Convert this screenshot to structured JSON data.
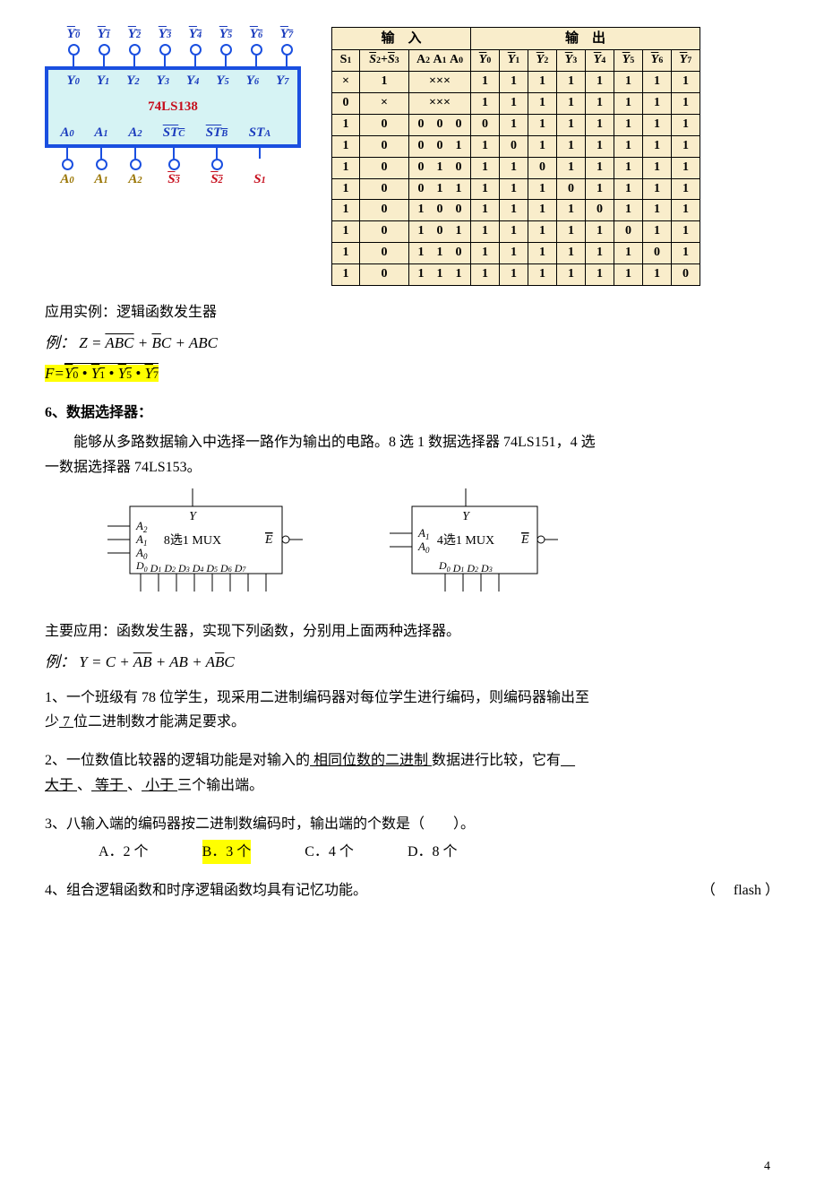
{
  "chip": {
    "name": "74LS138",
    "top_ext": [
      "Y0",
      "Y1",
      "Y2",
      "Y3",
      "Y4",
      "Y5",
      "Y6",
      "Y7"
    ],
    "top_int": [
      "Y0",
      "Y1",
      "Y2",
      "Y3",
      "Y4",
      "Y5",
      "Y6",
      "Y7"
    ],
    "bot_int": [
      "A0",
      "A1",
      "A2",
      "STC",
      "STB",
      "STA"
    ],
    "bot_ext": [
      "A0",
      "A1",
      "A2",
      "S3",
      "S2",
      "S1"
    ]
  },
  "truth_table": {
    "input_label": "输　入",
    "output_label": "输　出",
    "cols_in": [
      "S1",
      "S̄2+S̄3",
      "A2 A1 A0"
    ],
    "cols_out": [
      "Y0",
      "Y1",
      "Y2",
      "Y3",
      "Y4",
      "Y5",
      "Y6",
      "Y7"
    ],
    "rows": [
      {
        "s1": "×",
        "s23": "1",
        "a": "×××",
        "y": [
          "1",
          "1",
          "1",
          "1",
          "1",
          "1",
          "1",
          "1"
        ]
      },
      {
        "s1": "0",
        "s23": "×",
        "a": "×××",
        "y": [
          "1",
          "1",
          "1",
          "1",
          "1",
          "1",
          "1",
          "1"
        ]
      },
      {
        "s1": "1",
        "s23": "0",
        "a": "0  0  0",
        "y": [
          "0",
          "1",
          "1",
          "1",
          "1",
          "1",
          "1",
          "1"
        ]
      },
      {
        "s1": "1",
        "s23": "0",
        "a": "0  0  1",
        "y": [
          "1",
          "0",
          "1",
          "1",
          "1",
          "1",
          "1",
          "1"
        ]
      },
      {
        "s1": "1",
        "s23": "0",
        "a": "0  1  0",
        "y": [
          "1",
          "1",
          "0",
          "1",
          "1",
          "1",
          "1",
          "1"
        ]
      },
      {
        "s1": "1",
        "s23": "0",
        "a": "0  1  1",
        "y": [
          "1",
          "1",
          "1",
          "0",
          "1",
          "1",
          "1",
          "1"
        ]
      },
      {
        "s1": "1",
        "s23": "0",
        "a": "1  0  0",
        "y": [
          "1",
          "1",
          "1",
          "1",
          "0",
          "1",
          "1",
          "1"
        ]
      },
      {
        "s1": "1",
        "s23": "0",
        "a": "1  0  1",
        "y": [
          "1",
          "1",
          "1",
          "1",
          "1",
          "0",
          "1",
          "1"
        ]
      },
      {
        "s1": "1",
        "s23": "0",
        "a": "1  1  0",
        "y": [
          "1",
          "1",
          "1",
          "1",
          "1",
          "1",
          "0",
          "1"
        ]
      },
      {
        "s1": "1",
        "s23": "0",
        "a": "1  1  1",
        "y": [
          "1",
          "1",
          "1",
          "1",
          "1",
          "1",
          "1",
          "0"
        ]
      }
    ]
  },
  "text": {
    "app_example": "应用实例：逻辑函数发生器",
    "ex_label": "例：",
    "formula_Z": "Z = A̅B̅C̅ + B̅C + ABC",
    "formula_F": "F= Y̅0 • Y̅1 • Y̅5 • Y̅7",
    "sec6_title": "6、数据选择器："
  },
  "sec6": {
    "desc_1": "能够从多路数据输入中选择一路作为输出的电路。8 选 1 数据选择器 74LS151，4 选",
    "desc_2": "一数据选择器 74LS153。"
  },
  "mux8": {
    "Y": "Y",
    "A2": "A2",
    "A1": "A1",
    "A0": "A0",
    "label": "8选1 MUX",
    "E": "E̅",
    "D": "D0 D1 D2 D3 D4 D5 D6 D7"
  },
  "mux4": {
    "Y": "Y",
    "A1": "A1",
    "A0": "A0",
    "label": "4选1 MUX",
    "E": "E̅",
    "D": "D0 D1 D2 D3"
  },
  "app2": "主要应用：函数发生器，实现下列函数，分别用上面两种选择器。",
  "formula_Y": "Y = C + A̅B̅ + AB + AB̅C",
  "q1": {
    "prefix": "1、一个班级有 78 位学生，现采用二进制编码器对每位学生进行编码，则编码器输出至",
    "line2a": "少",
    "ans": "  7  ",
    "line2b": "位二进制数才能满足要求。"
  },
  "q2": {
    "prefix": "2、一位数值比较器的逻辑功能是对输入的",
    "ans1": "  相同位数的二进制 ",
    "mid": "数据进行比较，它有",
    "ans2a": " 大于 ",
    "sep1": "、",
    "ans2b": "  等于  ",
    "sep2": "、",
    "ans2c": " 小于  ",
    "tail": "三个输出端。"
  },
  "q3": {
    "text": "3、八输入端的编码器按二进制数编码时，输出端的个数是（　　）。",
    "A": "A．2 个",
    "B": "B．3 个",
    "C": "C．4 个",
    "D": "D．8 个"
  },
  "q4": {
    "text": "4、组合逻辑函数和时序逻辑函数均具有记忆功能。",
    "paren": "（　 flash  ）"
  },
  "page_number": "4",
  "chart_data": {
    "type": "table",
    "title": "74LS138 truth table",
    "columns": [
      "S1",
      "S̄2+S̄3",
      "A2",
      "A1",
      "A0",
      "Y̅0",
      "Y̅1",
      "Y̅2",
      "Y̅3",
      "Y̅4",
      "Y̅5",
      "Y̅6",
      "Y̅7"
    ],
    "rows": [
      [
        "X",
        "1",
        "X",
        "X",
        "X",
        "1",
        "1",
        "1",
        "1",
        "1",
        "1",
        "1",
        "1"
      ],
      [
        "0",
        "X",
        "X",
        "X",
        "X",
        "1",
        "1",
        "1",
        "1",
        "1",
        "1",
        "1",
        "1"
      ],
      [
        "1",
        "0",
        "0",
        "0",
        "0",
        "0",
        "1",
        "1",
        "1",
        "1",
        "1",
        "1",
        "1"
      ],
      [
        "1",
        "0",
        "0",
        "0",
        "1",
        "1",
        "0",
        "1",
        "1",
        "1",
        "1",
        "1",
        "1"
      ],
      [
        "1",
        "0",
        "0",
        "1",
        "0",
        "1",
        "1",
        "0",
        "1",
        "1",
        "1",
        "1",
        "1"
      ],
      [
        "1",
        "0",
        "0",
        "1",
        "1",
        "1",
        "1",
        "1",
        "0",
        "1",
        "1",
        "1",
        "1"
      ],
      [
        "1",
        "0",
        "1",
        "0",
        "0",
        "1",
        "1",
        "1",
        "1",
        "0",
        "1",
        "1",
        "1"
      ],
      [
        "1",
        "0",
        "1",
        "0",
        "1",
        "1",
        "1",
        "1",
        "1",
        "1",
        "0",
        "1",
        "1"
      ],
      [
        "1",
        "0",
        "1",
        "1",
        "0",
        "1",
        "1",
        "1",
        "1",
        "1",
        "1",
        "0",
        "1"
      ],
      [
        "1",
        "0",
        "1",
        "1",
        "1",
        "1",
        "1",
        "1",
        "1",
        "1",
        "1",
        "1",
        "0"
      ]
    ]
  }
}
